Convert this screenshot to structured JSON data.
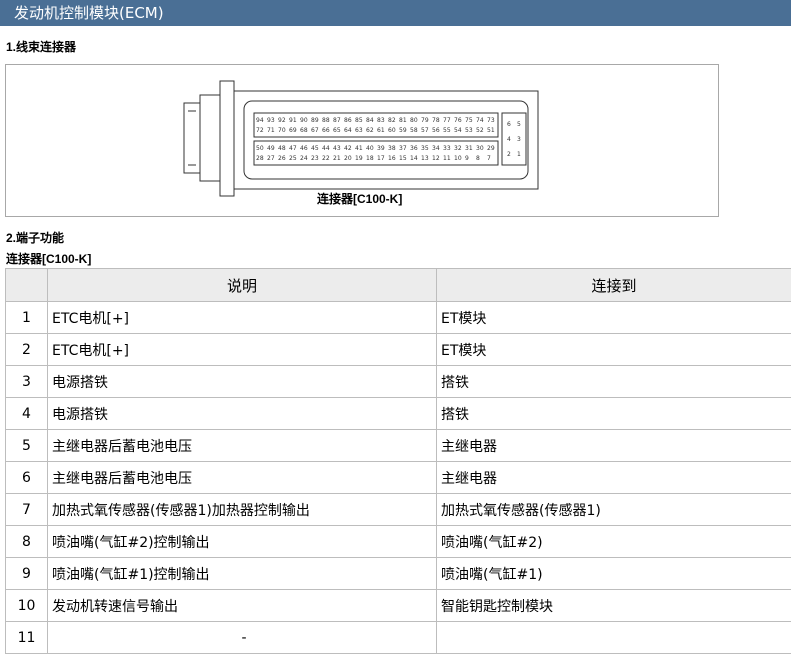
{
  "page": {
    "title": "发动机控制模块(ECM)",
    "section1": "1.线束连接器",
    "section2": "2.端子功能",
    "connector_label": "连接器[C100-K]"
  },
  "figure": {
    "label": "连接器[C100-K]",
    "pin_rows": [
      [
        "94",
        "93",
        "92",
        "91",
        "90",
        "89",
        "88",
        "87",
        "86",
        "85",
        "84",
        "83",
        "82",
        "81",
        "80",
        "79",
        "78",
        "77",
        "76",
        "75",
        "74",
        "73"
      ],
      [
        "72",
        "71",
        "70",
        "69",
        "68",
        "67",
        "66",
        "65",
        "64",
        "63",
        "62",
        "61",
        "60",
        "59",
        "58",
        "57",
        "56",
        "55",
        "54",
        "53",
        "52",
        "51"
      ],
      [
        "50",
        "49",
        "48",
        "47",
        "46",
        "45",
        "44",
        "43",
        "42",
        "41",
        "40",
        "39",
        "38",
        "37",
        "36",
        "35",
        "34",
        "33",
        "32",
        "31",
        "30",
        "29"
      ],
      [
        "28",
        "27",
        "26",
        "25",
        "24",
        "23",
        "22",
        "21",
        "20",
        "19",
        "18",
        "17",
        "16",
        "15",
        "14",
        "13",
        "12",
        "11",
        "10",
        "9",
        "8",
        "7"
      ]
    ],
    "side_pins": [
      [
        "6",
        "5"
      ],
      [
        "4",
        "3"
      ],
      [
        "2",
        "1"
      ]
    ]
  },
  "table": {
    "headers": [
      "",
      "说明",
      "连接到"
    ],
    "rows": [
      {
        "n": "1",
        "desc": "ETC电机[+]",
        "to": "ET模块"
      },
      {
        "n": "2",
        "desc": "ETC电机[+]",
        "to": "ET模块"
      },
      {
        "n": "3",
        "desc": "电源搭铁",
        "to": "搭铁"
      },
      {
        "n": "4",
        "desc": "电源搭铁",
        "to": "搭铁"
      },
      {
        "n": "5",
        "desc": "主继电器后蓄电池电压",
        "to": "主继电器"
      },
      {
        "n": "6",
        "desc": "主继电器后蓄电池电压",
        "to": "主继电器"
      },
      {
        "n": "7",
        "desc": "加热式氧传感器(传感器1)加热器控制输出",
        "to": "加热式氧传感器(传感器1)"
      },
      {
        "n": "8",
        "desc": "喷油嘴(气缸#2)控制输出",
        "to": "喷油嘴(气缸#2)"
      },
      {
        "n": "9",
        "desc": "喷油嘴(气缸#1)控制输出",
        "to": "喷油嘴(气缸#1)"
      },
      {
        "n": "10",
        "desc": "发动机转速信号输出",
        "to": "智能钥匙控制模块"
      },
      {
        "n": "11",
        "desc": "-",
        "to": ""
      }
    ]
  }
}
